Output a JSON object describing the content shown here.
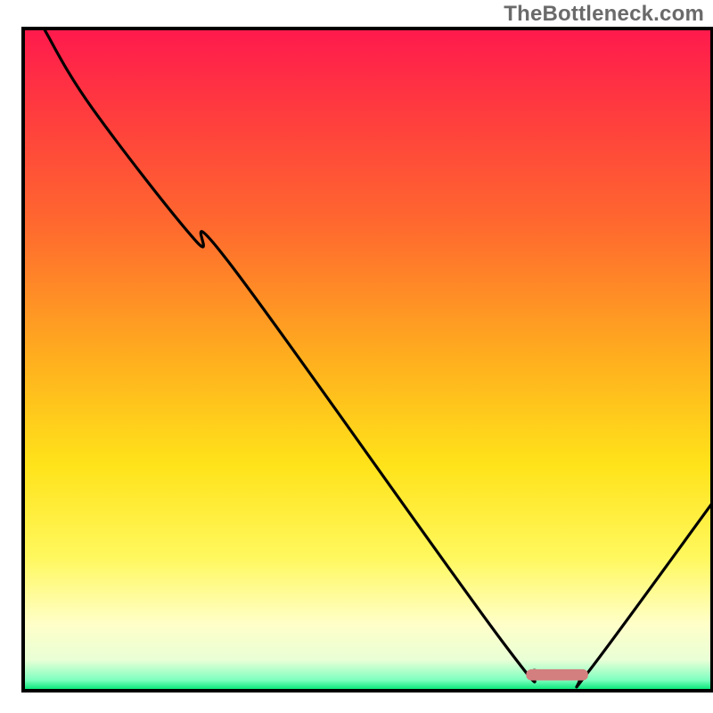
{
  "watermark": "TheBottleneck.com",
  "colors": {
    "frame": "#000000",
    "curve": "#000000",
    "marker": "#d47f7f",
    "gradient_stops": [
      {
        "offset": 0.0,
        "color": "#ff1a4d"
      },
      {
        "offset": 0.12,
        "color": "#ff3a3f"
      },
      {
        "offset": 0.3,
        "color": "#ff6a2e"
      },
      {
        "offset": 0.5,
        "color": "#ffaf1e"
      },
      {
        "offset": 0.66,
        "color": "#ffe31a"
      },
      {
        "offset": 0.8,
        "color": "#fff85e"
      },
      {
        "offset": 0.9,
        "color": "#ffffc8"
      },
      {
        "offset": 0.955,
        "color": "#e9ffd6"
      },
      {
        "offset": 0.985,
        "color": "#7fffc0"
      },
      {
        "offset": 1.0,
        "color": "#00e676"
      }
    ]
  },
  "chart_data": {
    "type": "line",
    "title": "",
    "xlabel": "",
    "ylabel": "",
    "xlim": [
      0,
      100
    ],
    "ylim": [
      0,
      100
    ],
    "grid": false,
    "legend": "none",
    "series": [
      {
        "name": "bottleneck-curve",
        "x": [
          3,
          10,
          25,
          30,
          69.5,
          74.5,
          80.5,
          82,
          100
        ],
        "y": [
          100,
          88,
          68,
          64.5,
          7.5,
          3,
          2.3,
          2.8,
          28.3
        ]
      }
    ],
    "marker": {
      "x_center": 77.5,
      "x_halfwidth": 4.5,
      "y": 2.4,
      "thickness_pct": 1.7
    }
  }
}
